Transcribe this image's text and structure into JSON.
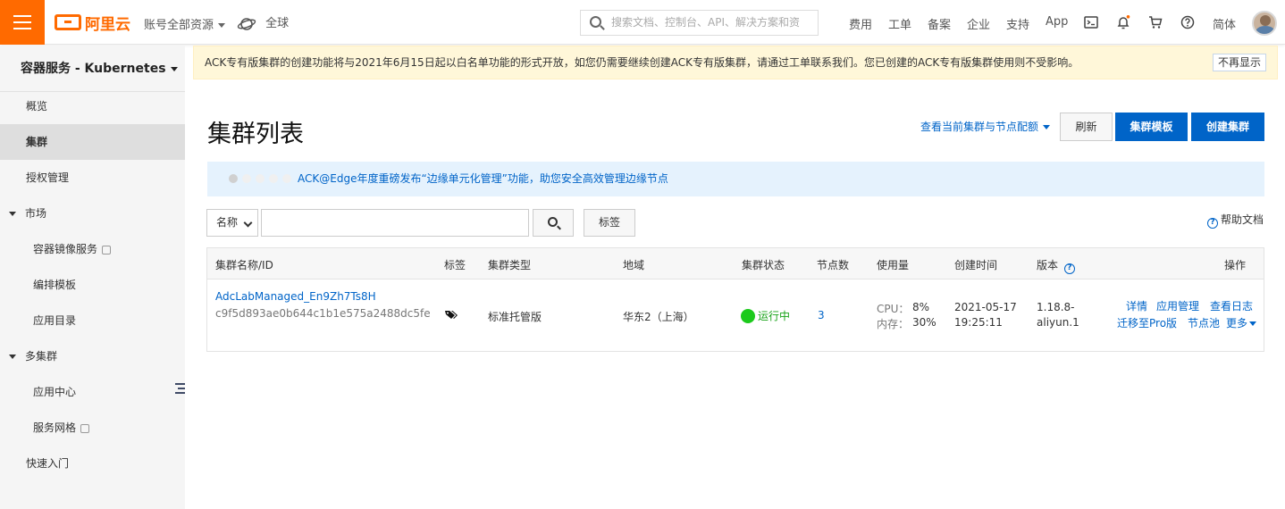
{
  "topbar": {
    "logo_text": "阿里云",
    "account_scope": "账号全部资源",
    "region": "全球",
    "search_placeholder": "搜索文档、控制台、API、解决方案和资",
    "nav": [
      "费用",
      "工单",
      "备案",
      "企业",
      "支持",
      "App"
    ],
    "language": "简体"
  },
  "sidebar": {
    "title": "容器服务 - Kubernetes",
    "items": [
      {
        "label": "概览"
      },
      {
        "label": "集群"
      },
      {
        "label": "授权管理"
      },
      {
        "label": "市场"
      },
      {
        "label": "容器镜像服务"
      },
      {
        "label": "编排模板"
      },
      {
        "label": "应用目录"
      },
      {
        "label": "多集群"
      },
      {
        "label": "应用中心"
      },
      {
        "label": "服务网格"
      },
      {
        "label": "快速入门"
      }
    ]
  },
  "notice": {
    "text": "ACK专有版集群的创建功能将与2021年6月15日起以白名单功能的形式开放，如您仍需要继续创建ACK专有版集群，请通过工单联系我们。您已创建的ACK专有版集群使用则不受影响。",
    "dismiss": "不再显示"
  },
  "header": {
    "title": "集群列表",
    "quota_link": "查看当前集群与节点配额",
    "refresh": "刷新",
    "template": "集群模板",
    "create": "创建集群"
  },
  "banner": {
    "text": "ACK@Edge年度重磅发布“边缘单元化管理”功能，助您安全高效管理边缘节点"
  },
  "filter": {
    "select_value": "名称",
    "tag_button": "标签",
    "help": "帮助文档"
  },
  "table": {
    "columns": [
      "集群名称/ID",
      "标签",
      "集群类型",
      "地域",
      "集群状态",
      "节点数",
      "使用量",
      "创建时间",
      "版本",
      "操作"
    ],
    "version_help": "?",
    "row": {
      "name": "AdcLabManaged_En9Zh7Ts8H",
      "id": "c9f5d893ae0b644c1b1e575a2488dc5fe",
      "type": "标准托管版",
      "region": "华东2（上海）",
      "status": "运行中",
      "nodes": "3",
      "cpu_label": "CPU：",
      "cpu_value": "8%",
      "mem_label": "内存：",
      "mem_value": "30%",
      "created_date": "2021-05-17",
      "created_time": "19:25:11",
      "version_line1": "1.18.8-",
      "version_line2": "aliyun.1",
      "actions": [
        "详情",
        "应用管理",
        "查看日志",
        "迁移至Pro版",
        "节点池",
        "更多"
      ]
    }
  },
  "colors": {
    "brand": "#ff6a00",
    "primary": "#0064c8",
    "running": "#1cca1c",
    "notice_bg": "#fff7d9",
    "banner_bg": "#e5f2fd"
  }
}
